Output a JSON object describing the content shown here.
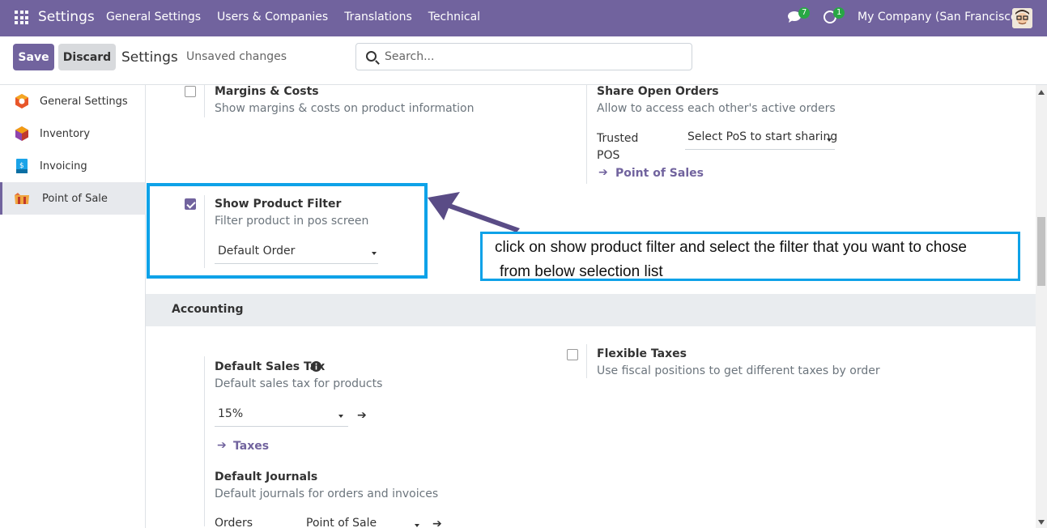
{
  "navbar": {
    "brand": "Settings",
    "menu": [
      "General Settings",
      "Users & Companies",
      "Translations",
      "Technical"
    ],
    "chat_count": "7",
    "activity_count": "1",
    "company": "My Company (San Francisco)"
  },
  "control": {
    "save_label": "Save",
    "discard_label": "Discard",
    "title": "Settings",
    "status": "Unsaved changes",
    "search_placeholder": "Search..."
  },
  "sidebar": {
    "items": [
      {
        "label": "General Settings",
        "icon": "general-settings-icon",
        "color": "#e8562a"
      },
      {
        "label": "Inventory",
        "icon": "inventory-icon",
        "color": "#d1573b"
      },
      {
        "label": "Invoicing",
        "icon": "invoicing-icon",
        "color": "#1aa3e8"
      },
      {
        "label": "Point of Sale",
        "icon": "point-of-sale-icon",
        "color": "#e36f3e"
      }
    ]
  },
  "settings": {
    "margins": {
      "title": "Margins & Costs",
      "desc": "Show margins & costs on product information",
      "checked": false
    },
    "share_orders": {
      "title": "Share Open Orders",
      "desc": "Allow to access each other's active orders",
      "trusted_label_1": "Trusted",
      "trusted_label_2": "POS",
      "trusted_select": "Select PoS to start sharing",
      "link": "Point of Sales"
    },
    "product_filter": {
      "title": "Show Product Filter",
      "desc": "Filter product in pos screen",
      "checked": true,
      "select_value": "Default Order"
    },
    "accounting": {
      "section": "Accounting",
      "sales_tax": {
        "title": "Default Sales Tax",
        "desc": "Default sales tax for products",
        "value": "15%",
        "link": "Taxes"
      },
      "flexible_taxes": {
        "title": "Flexible Taxes",
        "desc": "Use fiscal positions to get different taxes by order",
        "checked": false
      },
      "journals": {
        "title": "Default Journals",
        "desc": "Default journals for orders and invoices",
        "orders_label": "Orders",
        "orders_value": "Point of Sale"
      }
    }
  },
  "annotation": {
    "line1": "click on show product filter and select the filter that you want to chose",
    "line2": "from below selection list"
  },
  "colors": {
    "brand": "#71639e",
    "highlight": "#0ea2e8"
  }
}
